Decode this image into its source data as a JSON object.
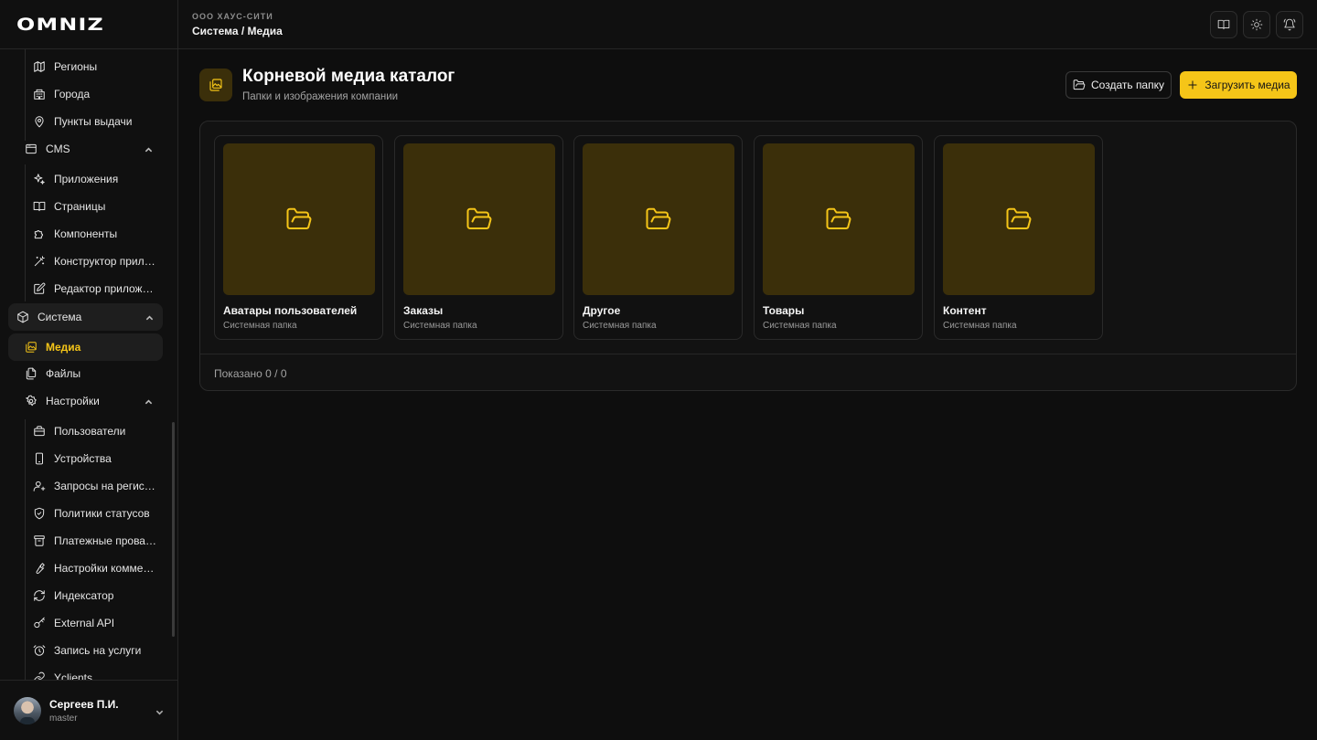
{
  "app": {
    "logo": "OMNIZ"
  },
  "header": {
    "org": "ООО ХАУС-СИТИ",
    "breadcrumb": "Система / Медиа",
    "icons": [
      "book-open-icon",
      "sun-icon",
      "bell-icon"
    ]
  },
  "sidebar": {
    "items": [
      {
        "label": "Регионы",
        "icon": "map-icon"
      },
      {
        "label": "Города",
        "icon": "building-icon"
      },
      {
        "label": "Пункты выдачи",
        "icon": "map-pin-icon"
      },
      {
        "label": "CMS",
        "icon": "browser-window-icon",
        "expanded": true
      },
      {
        "label": "Приложения",
        "icon": "sparkles-icon"
      },
      {
        "label": "Страницы",
        "icon": "book-icon"
      },
      {
        "label": "Компоненты",
        "icon": "puzzle-icon"
      },
      {
        "label": "Конструктор приложений",
        "icon": "wand-icon"
      },
      {
        "label": "Редактор приложений",
        "icon": "edit-icon"
      },
      {
        "label": "Система",
        "icon": "cube-icon",
        "expanded": true
      },
      {
        "label": "Медиа",
        "icon": "images-icon",
        "active": true
      },
      {
        "label": "Файлы",
        "icon": "files-icon"
      },
      {
        "label": "Настройки",
        "icon": "gear-icon",
        "expanded": true
      },
      {
        "label": "Пользователи",
        "icon": "briefcase-icon"
      },
      {
        "label": "Устройства",
        "icon": "smartphone-icon"
      },
      {
        "label": "Запросы на регистрацию",
        "icon": "user-plus-icon"
      },
      {
        "label": "Политики статусов",
        "icon": "shield-icon"
      },
      {
        "label": "Платежные провайдеры",
        "icon": "archive-icon"
      },
      {
        "label": "Настройки коммерции",
        "icon": "wrench-icon"
      },
      {
        "label": "Индексатор",
        "icon": "refresh-icon"
      },
      {
        "label": "External API",
        "icon": "key-icon"
      },
      {
        "label": "Запись на услуги",
        "icon": "alarm-clock-icon"
      },
      {
        "label": "Yclients",
        "icon": "link-icon"
      }
    ]
  },
  "user": {
    "name": "Сергеев П.И.",
    "role": "master"
  },
  "page": {
    "title": "Корневой медиа каталог",
    "subtitle": "Папки и изображения компании",
    "create_folder_label": "Создать папку",
    "upload_label": "Загрузить медиа"
  },
  "folders": [
    {
      "name": "Аватары пользователей",
      "type": "Системная папка"
    },
    {
      "name": "Заказы",
      "type": "Системная папка"
    },
    {
      "name": "Другое",
      "type": "Системная папка"
    },
    {
      "name": "Товары",
      "type": "Системная папка"
    },
    {
      "name": "Контент",
      "type": "Системная папка"
    }
  ],
  "footer": {
    "shown": "Показано 0 / 0"
  },
  "colors": {
    "accent": "#f5c518",
    "accent_bg": "#3b2f0a",
    "background": "#0e0e0e"
  }
}
